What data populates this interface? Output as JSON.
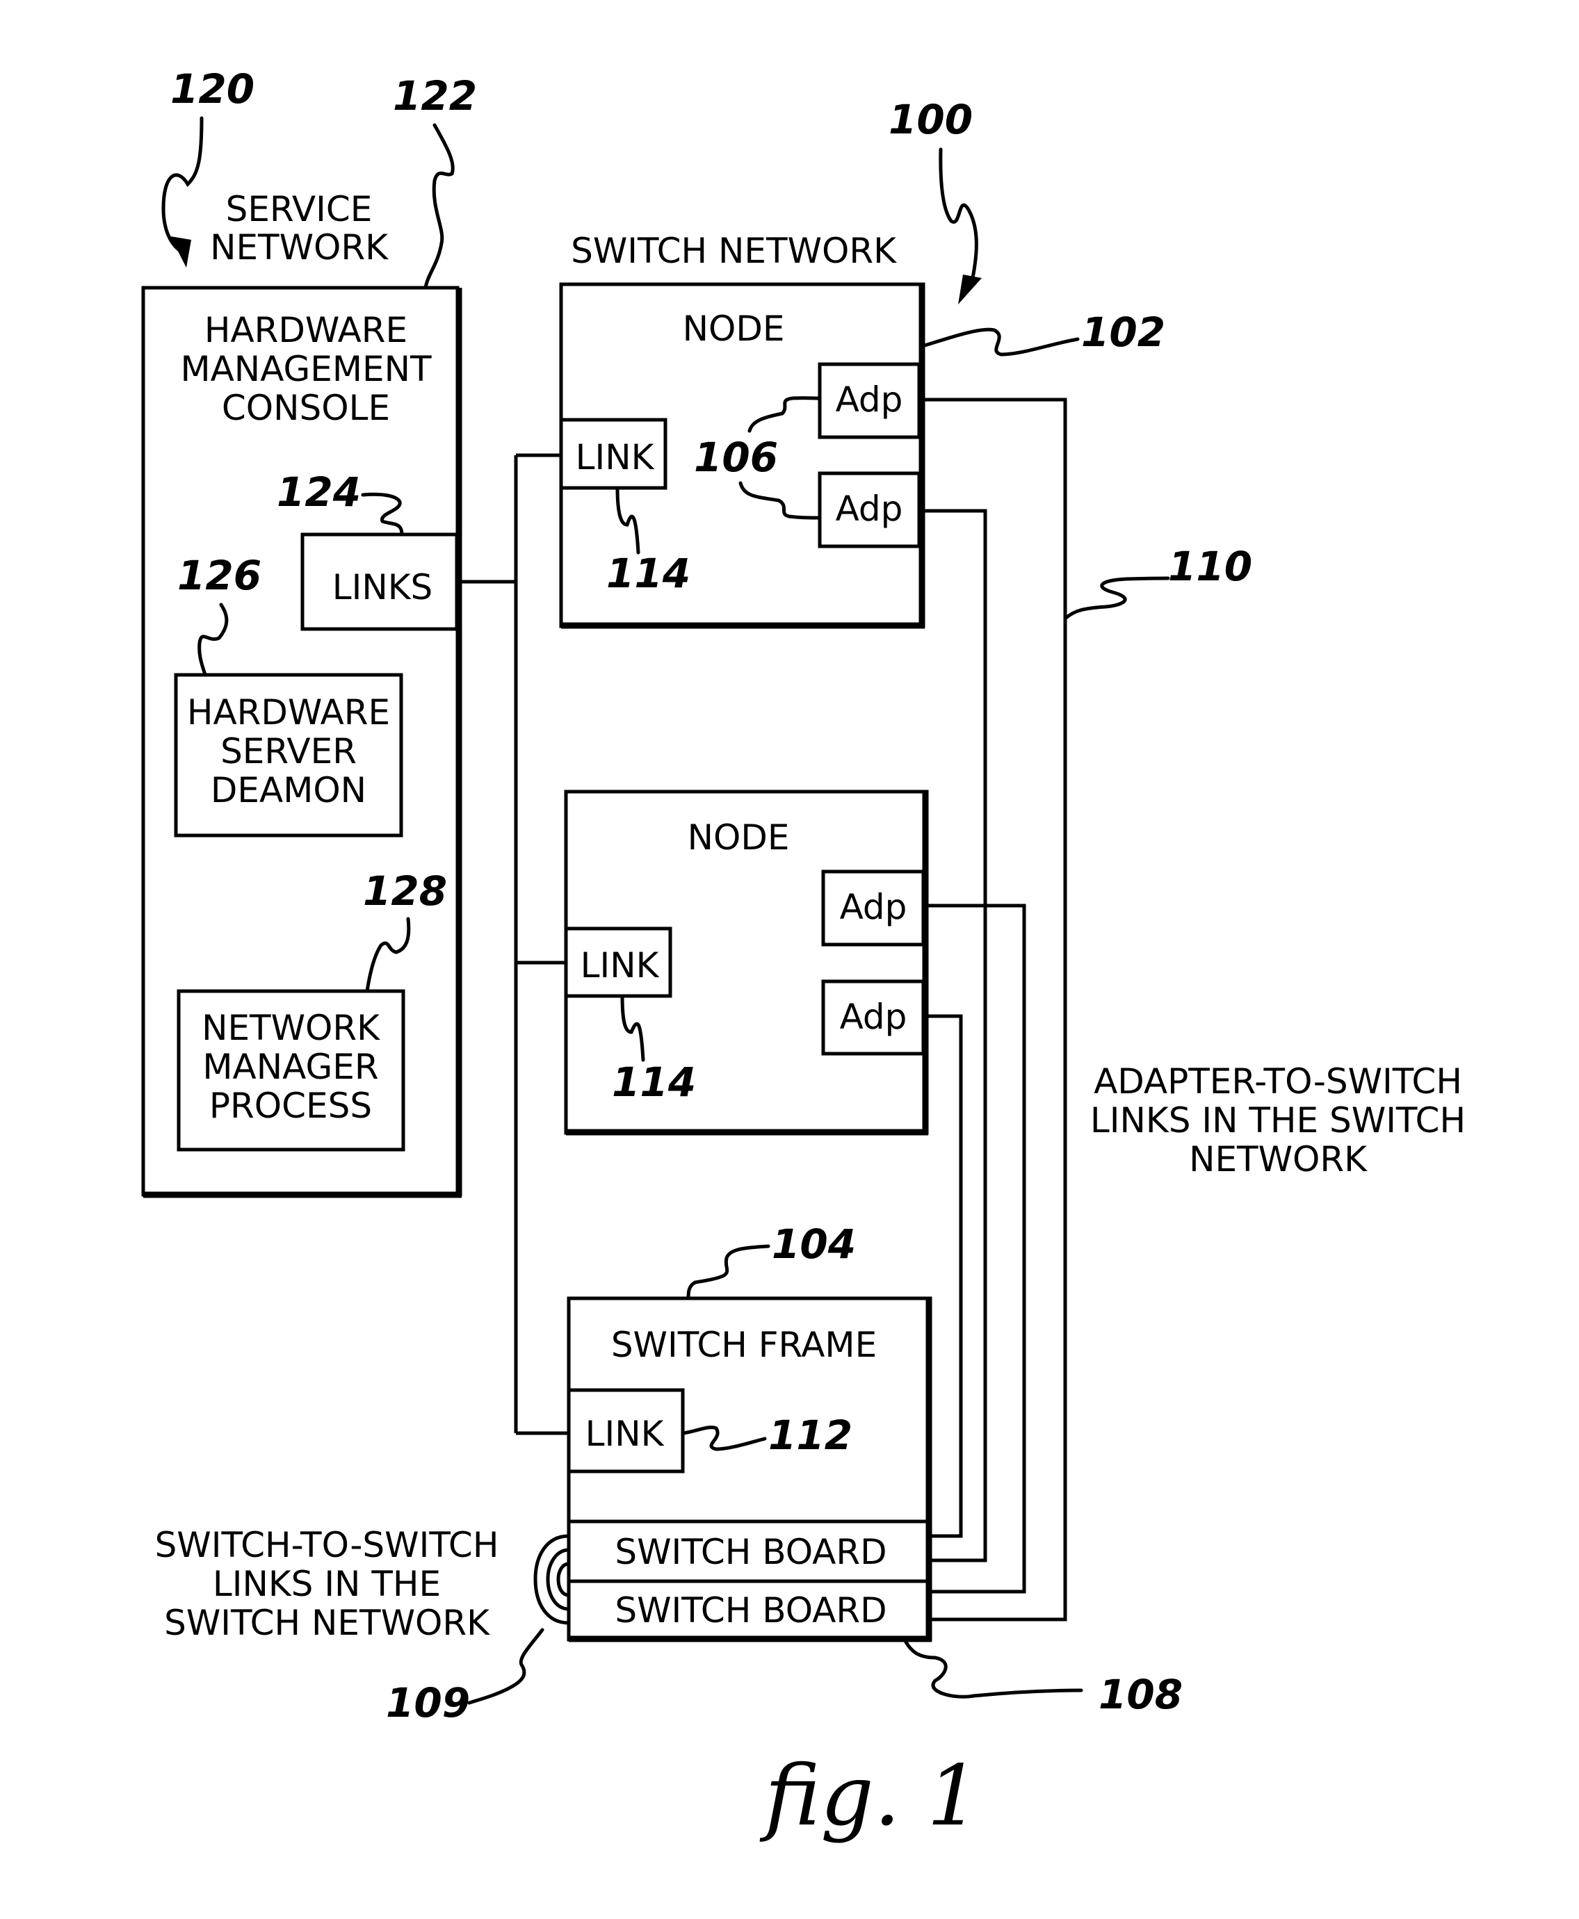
{
  "figure": {
    "caption": "fig. 1"
  },
  "service_network": {
    "ref": "120",
    "label_lines": [
      "SERVICE",
      "NETWORK"
    ],
    "hmc": {
      "ref": "122",
      "title_lines": [
        "HARDWARE",
        "MANAGEMENT",
        "CONSOLE"
      ],
      "links": {
        "ref": "124",
        "label": "LINKS"
      },
      "hardware_server_daemon": {
        "ref": "126",
        "label_lines": [
          "HARDWARE",
          "SERVER",
          "DEAMON"
        ]
      },
      "network_manager_process": {
        "ref": "128",
        "label_lines": [
          "NETWORK",
          "MANAGER",
          "PROCESS"
        ]
      }
    }
  },
  "switch_network": {
    "ref": "100",
    "label": "SWITCH NETWORK",
    "nodes": [
      {
        "ref": "102",
        "label": "NODE",
        "link_label": "LINK",
        "link_ref": "114",
        "adapter_ref": "106",
        "adapters": [
          "Adp",
          "Adp"
        ]
      },
      {
        "label": "NODE",
        "link_label": "LINK",
        "link_ref": "114",
        "adapters": [
          "Adp",
          "Adp"
        ]
      }
    ],
    "switch_frame": {
      "ref": "104",
      "label": "SWITCH FRAME",
      "link_label": "LINK",
      "link_ref": "112",
      "boards_ref": "108",
      "boards": [
        "SWITCH BOARD",
        "SWITCH BOARD"
      ]
    },
    "adapter_links": {
      "ref": "110",
      "label_lines": [
        "ADAPTER-TO-SWITCH",
        "LINKS IN THE SWITCH",
        "NETWORK"
      ]
    },
    "switch_links": {
      "ref": "109",
      "label_lines": [
        "SWITCH-TO-SWITCH",
        "LINKS IN THE",
        "SWITCH NETWORK"
      ]
    }
  }
}
